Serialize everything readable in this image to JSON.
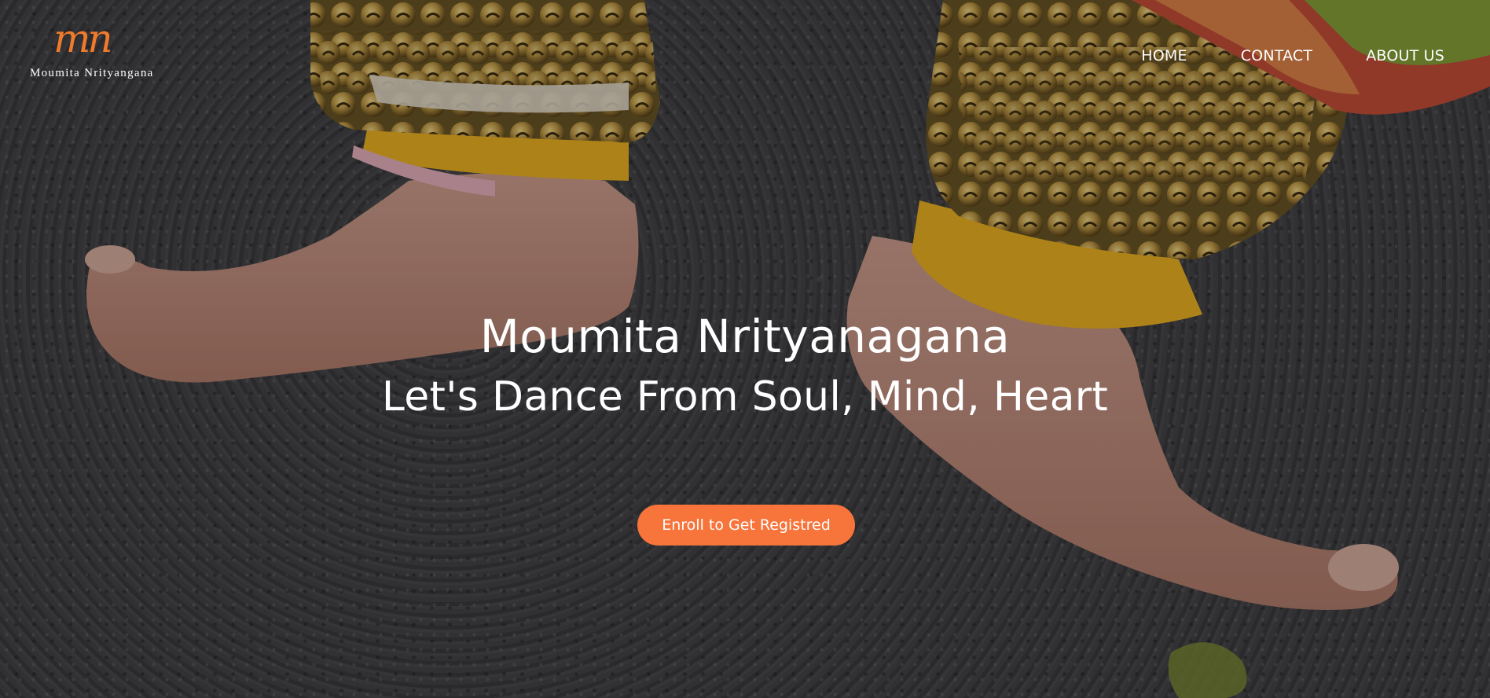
{
  "brand": {
    "logo_mark": "mn",
    "name": "Moumita Nrityangana",
    "accent_color": "#f07a2c"
  },
  "nav": {
    "items": [
      {
        "label": "HOME"
      },
      {
        "label": "CONTACT"
      },
      {
        "label": "ABOUT US"
      }
    ]
  },
  "hero": {
    "title": "Moumita Nrityanagana",
    "subtitle": "Let's Dance From Soul, Mind, Heart",
    "cta_label": "Enroll to Get Registred",
    "cta_color": "#f7743b",
    "background_image": "dancer-feet-with-ghungroo-bells-on-asphalt"
  }
}
